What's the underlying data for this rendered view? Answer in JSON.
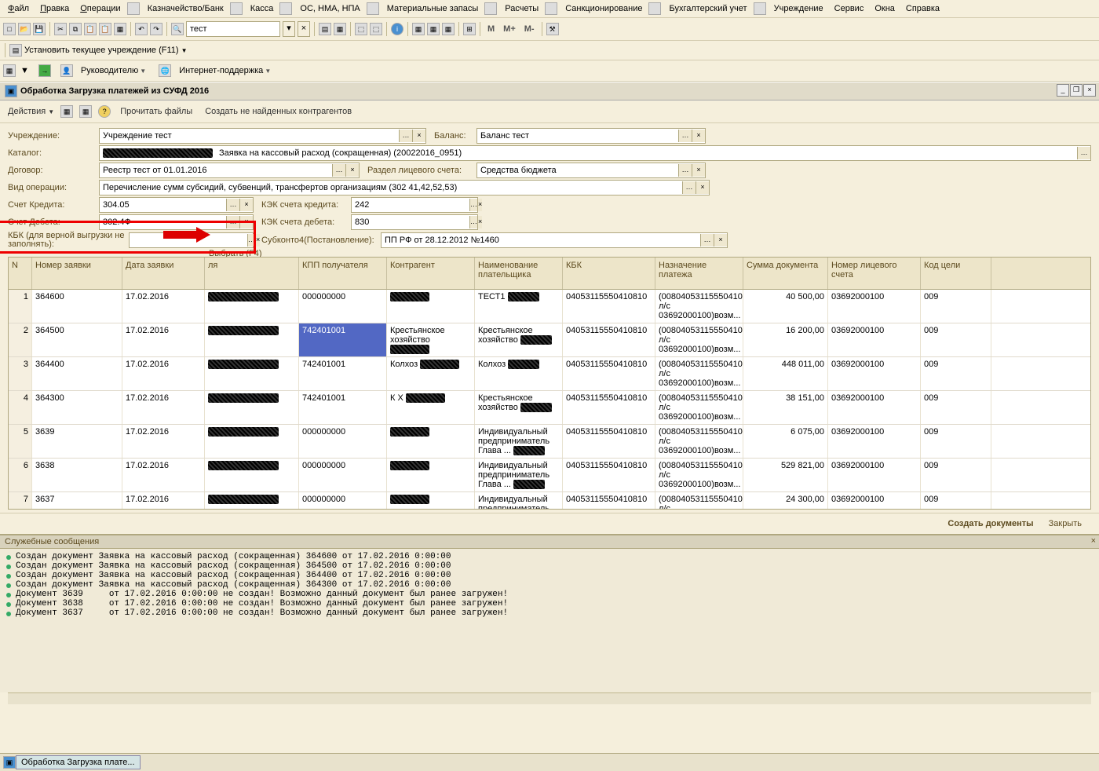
{
  "menu": [
    "Файл",
    "Правка",
    "Операции",
    "Казначейство/Банк",
    "Касса",
    "ОС, НМА, НПА",
    "Материальные запасы",
    "Расчеты",
    "Санкционирование",
    "Бухгалтерский учет",
    "Учреждение",
    "Сервис",
    "Окна",
    "Справка"
  ],
  "menu_underline": [
    0,
    0,
    0,
    -1,
    -1,
    -1,
    -1,
    -1,
    -1,
    -1,
    -1,
    -1,
    -1,
    -1
  ],
  "search_value": "тест",
  "toolbar_text": [
    "M",
    "M+",
    "M-"
  ],
  "set_org_label": "Установить текущее учреждение (F11)",
  "tb2_manager": "Руководителю",
  "tb2_support": "Интернет-поддержка",
  "doc_title": "Обработка  Загрузка платежей из СУФД 2016",
  "doc_actions": "Действия",
  "doc_read": "Прочитать файлы",
  "doc_create": "Создать не найденных контрагентов",
  "form": {
    "org_label": "Учреждение:",
    "org_value": "Учреждение тест",
    "balance_label": "Баланс:",
    "balance_value": "Баланс тест",
    "catalog_label": "Каталог:",
    "catalog_value": "Заявка на кассовый расход (сокращенная) (20022016_0951)",
    "contract_label": "Договор:",
    "contract_value": "Реестр тест от 01.01.2016",
    "account_section_label": "Раздел лицевого счета:",
    "account_section_value": "Средства бюджета",
    "op_type_label": "Вид операции:",
    "op_type_value": "Перечисление сумм субсидий, субвенций, трансфертов организациям (302 41,42,52,53)",
    "credit_label": "Счет Кредита:",
    "credit_value": "304.05",
    "credit_kek_label": "КЭК счета кредита:",
    "credit_kek_value": "242",
    "debit_label": "Счет Дебета:",
    "debit_value": "302.4Ф",
    "debit_kek_label": "КЭК счета дебета:",
    "debit_kek_value": "830",
    "kbk_label": "КБК (для верной выгрузки не заполнять):",
    "kbk_value": "",
    "sub4_label": "Субконто4(Постановление):",
    "sub4_value": "ПП РФ от 28.12.2012 №1460",
    "select_label": "Выбрать (F4)"
  },
  "grid": {
    "headers": [
      "N",
      "Номер заявки",
      "Дата заявки",
      "",
      "КПП получателя",
      "Контрагент",
      "Наименование плательщика",
      "КБК",
      "Назначение платежа",
      "Сумма документа",
      "Номер лицевого счета",
      "Код цели"
    ],
    "header_payer_hidden": "ля",
    "rows": [
      {
        "n": "1",
        "num": "364600",
        "date": "17.02.2016",
        "kpp": "000000000",
        "name": "ТЕСТ1",
        "kbk": "04053115550410810",
        "purpose": "(00804053115550410810. л/c 03692000100)возм...",
        "sum": "40 500,00",
        "acc": "03692000100",
        "goal": "009"
      },
      {
        "n": "2",
        "num": "364500",
        "date": "17.02.2016",
        "kpp": "742401001",
        "kpp_sel": true,
        "contr": "Крестьянское хозяйство",
        "name": "Крестьянское хозяйство",
        "kbk": "04053115550410810",
        "purpose": "(00804053115550410810. л/c 03692000100)возм...",
        "sum": "16 200,00",
        "acc": "03692000100",
        "goal": "009"
      },
      {
        "n": "3",
        "num": "364400",
        "date": "17.02.2016",
        "kpp": "742401001",
        "contr": "Колхоз",
        "name": "Колхоз",
        "kbk": "04053115550410810",
        "purpose": "(00804053115550410810. л/c 03692000100)возм...",
        "sum": "448 011,00",
        "acc": "03692000100",
        "goal": "009"
      },
      {
        "n": "4",
        "num": "364300",
        "date": "17.02.2016",
        "kpp": "742401001",
        "contr": "К Х",
        "name": "Крестьянское хозяйство",
        "kbk": "04053115550410810",
        "purpose": "(00804053115550410810. л/c 03692000100)возм...",
        "sum": "38 151,00",
        "acc": "03692000100",
        "goal": "009"
      },
      {
        "n": "5",
        "num": "3639",
        "date": "17.02.2016",
        "kpp": "000000000",
        "name": "Индивидуальный предприниматель Глава ...",
        "kbk": "04053115550410810",
        "purpose": "(00804053115550410810. л/c 03692000100)возм...",
        "sum": "6 075,00",
        "acc": "03692000100",
        "goal": "009"
      },
      {
        "n": "6",
        "num": "3638",
        "date": "17.02.2016",
        "kpp": "000000000",
        "name": "Индивидуальный предприниматель Глава ...",
        "kbk": "04053115550410810",
        "purpose": "(00804053115550410810. л/c 03692000100)возм...",
        "sum": "529 821,00",
        "acc": "03692000100",
        "goal": "009"
      },
      {
        "n": "7",
        "num": "3637",
        "date": "17.02.2016",
        "kpp": "000000000",
        "name": "Индивидуальный предприниматель",
        "kbk": "04053115550410810",
        "purpose": "(00804053115550410810. л/c",
        "sum": "24 300,00",
        "acc": "03692000100",
        "goal": "009"
      }
    ]
  },
  "footer": {
    "create": "Создать документы",
    "close": "Закрыть"
  },
  "msg_title": "Служебные сообщения",
  "messages": [
    "Создан документ Заявка на кассовый расход (сокращенная) 364600 от 17.02.2016 0:00:00",
    "Создан документ Заявка на кассовый расход (сокращенная) 364500 от 17.02.2016 0:00:00",
    "Создан документ Заявка на кассовый расход (сокращенная) 364400 от 17.02.2016 0:00:00",
    "Создан документ Заявка на кассовый расход (сокращенная) 364300 от 17.02.2016 0:00:00",
    "Документ 3639     от 17.02.2016 0:00:00 не создан! Возможно данный документ был ранее загружен!",
    "Документ 3638     от 17.02.2016 0:00:00 не создан! Возможно данный документ был ранее загружен!",
    "Документ 3637     от 17.02.2016 0:00:00 не создан! Возможно данный документ был ранее загружен!"
  ],
  "taskbar_tab": "Обработка  Загрузка плате..."
}
